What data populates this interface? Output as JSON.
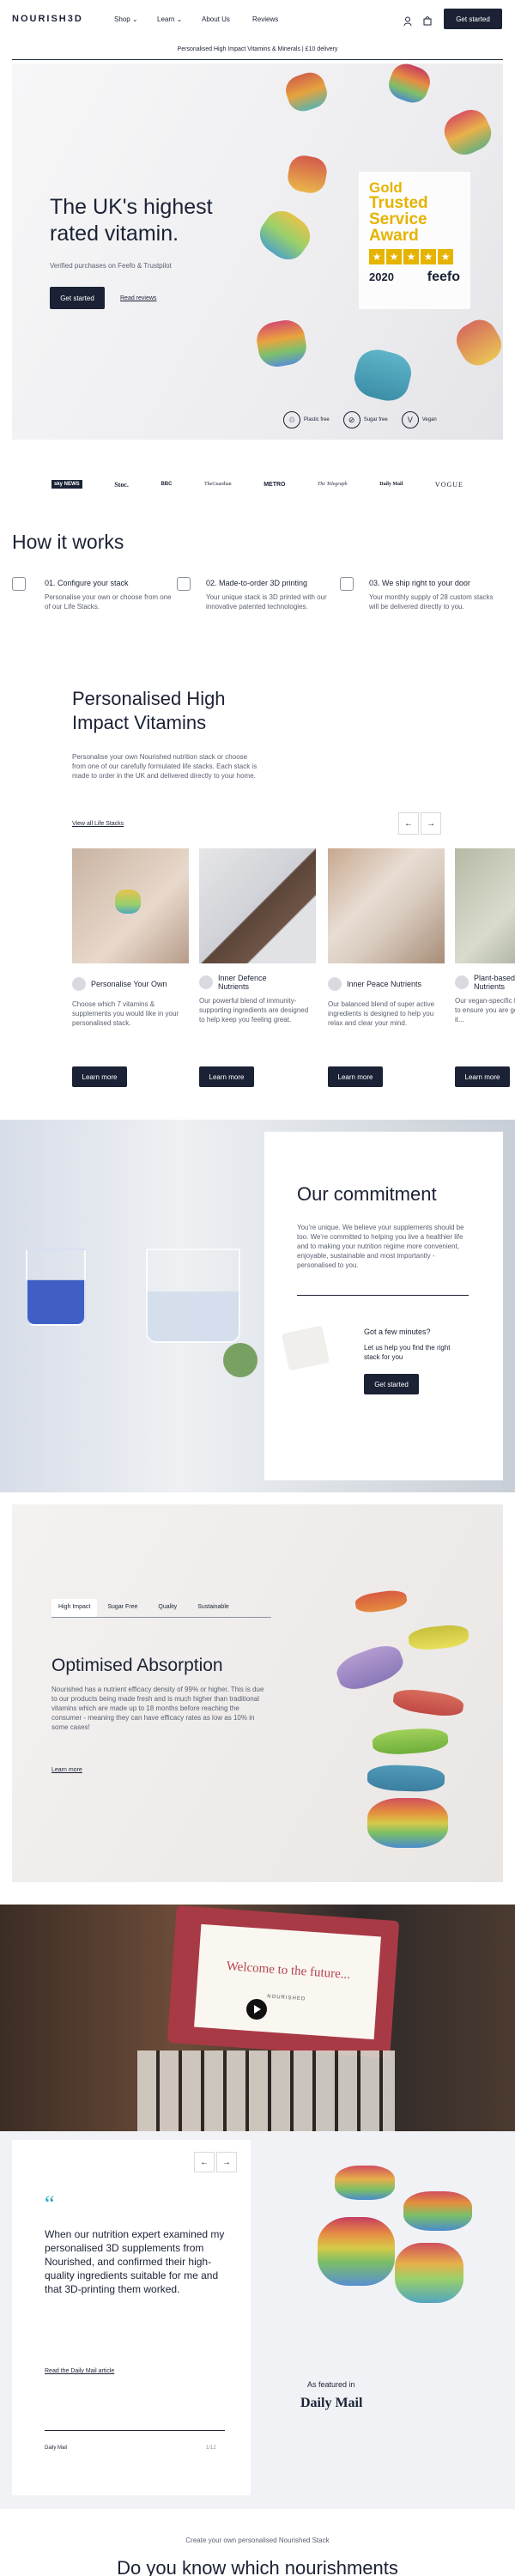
{
  "header": {
    "logo": "NOURISH3D",
    "nav": [
      {
        "label": "Shop ⌄"
      },
      {
        "label": "Learn ⌄"
      },
      {
        "label": "About Us"
      },
      {
        "label": "Reviews"
      }
    ],
    "cta": "Get started",
    "icons": [
      "user-icon",
      "bag-icon"
    ]
  },
  "announcement": "Personalised High Impact Vitamins & Minerals | £10 delivery",
  "hero": {
    "title": "The UK's highest rated vitamin.",
    "subtitle": "Verified purchases on Feefo & Trustpilot",
    "cta": "Get started",
    "link": "Read reviews",
    "award": {
      "line1": "Gold",
      "line2": "Trusted",
      "line3": "Service",
      "line4": "Award",
      "year": "2020",
      "brand": "feefo"
    },
    "badges": [
      "Plastic free",
      "Sugar free",
      "Vegan"
    ]
  },
  "press": [
    "sky NEWS",
    "Stoc.",
    "BBC",
    "TheGuardian",
    "METRO",
    "The Telegraph",
    "Daily Mail",
    "VOGUE"
  ],
  "how": {
    "title": "How it works",
    "steps": [
      {
        "title": "01. Configure your stack",
        "text": "Personalise your own or choose from one of our Life Stacks."
      },
      {
        "title": "02. Made-to-order 3D printing",
        "text": "Your unique stack is 3D printed with our innovative patented technologies."
      },
      {
        "title": "03. We ship right to your door",
        "text": "Your monthly supply of 28 custom stacks will be delivered directly to you."
      }
    ]
  },
  "vitamins": {
    "title": "Personalised High Impact Vitamins",
    "text": "Personalise your own Nourished nutrition stack or choose from one of our carefully formulated life stacks. Each stack is made to order in the UK and delivered directly to your home.",
    "link": "View all Life Stacks",
    "prev": "←",
    "next": "→",
    "cards": [
      {
        "title": "Personalise Your Own",
        "text": "Choose which 7 vitamins & supplements you would like in your personalised stack.",
        "cta": "Learn more"
      },
      {
        "title": "Inner Defence Nutrients",
        "text": "Our powerful blend of immunity-supporting ingredients are designed to help keep you feeling great.",
        "cta": "Learn more"
      },
      {
        "title": "Inner Peace Nutrients",
        "text": "Our balanced blend of super active ingredients is designed to help you relax and clear your mind.",
        "cta": "Learn more"
      },
      {
        "title": "Plant-based Nutrients",
        "text": "Our vegan-specific blend is designed to ensure you are getting everything it...",
        "cta": "Learn more"
      }
    ]
  },
  "commitment": {
    "title": "Our commitment",
    "text": "You're unique. We believe your supplements should be too. We're committed to helping you live a healthier life and to making your nutrition regime more convenient, enjoyable, sustainable and most importantly - personalised to you.",
    "q_title": "Got a few minutes?",
    "q_text": "Let us help you find the right stack for you",
    "cta": "Get started"
  },
  "absorption": {
    "tabs": [
      "High Impact",
      "Sugar Free",
      "Quality",
      "Sustainable"
    ],
    "title": "Optimised Absorption",
    "text": "Nourished has a nutrient efficacy density of 99% or higher. This is due to our products being made fresh and is much higher than traditional vitamins which are made up to 18 months before reaching the consumer - meaning they can have efficacy rates as low as 10% in some cases!",
    "link": "Learn more"
  },
  "video": {
    "card_text": "Welcome to the future...",
    "brand": "NOURISHED"
  },
  "testimonial": {
    "quote_mark": "“",
    "quote": "When our nutrition expert examined my personalised 3D supplements from Nourished, and confirmed their high-quality ingredients suitable for me and that 3D-printing them worked.",
    "link": "Read the Daily Mail article",
    "source": "Daily Mail",
    "count": "1/12",
    "prev": "←",
    "next": "→",
    "featured": "As featured in",
    "featured_brand": "Daily Mail"
  },
  "footer_teaser": {
    "small": "Create your own personalised Nourished Stack",
    "heading": "Do you know which nourishments"
  },
  "colors": {
    "navy": "#1b2235",
    "accent": "#2aa7b8",
    "gold": "#e5b300"
  }
}
